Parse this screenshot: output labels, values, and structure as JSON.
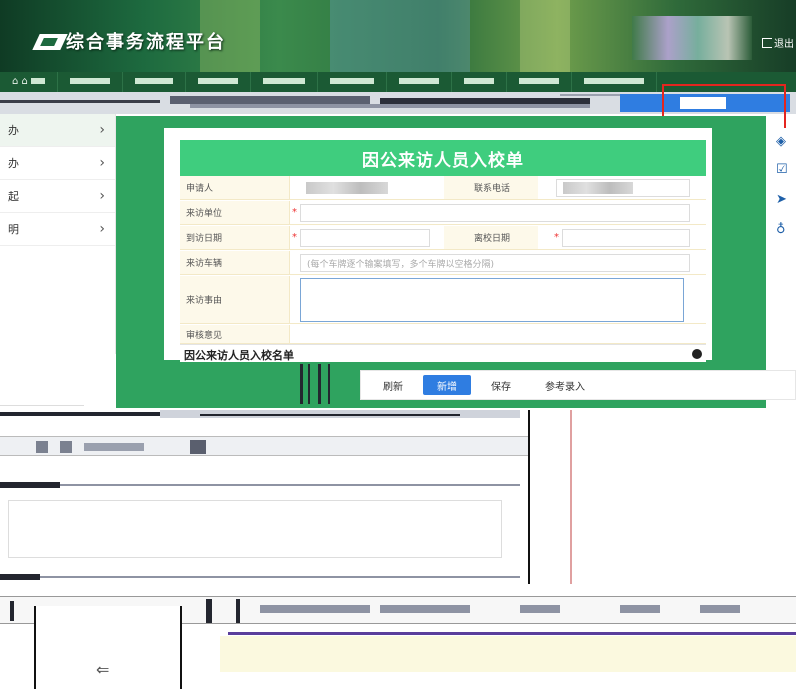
{
  "app": {
    "title": "综合事务流程平台",
    "logout_label": "退出"
  },
  "nav": {
    "items": [
      "",
      "",
      "",
      "",
      "",
      "",
      "",
      "",
      "",
      "",
      ""
    ]
  },
  "sidebar": {
    "items": [
      {
        "label": "办",
        "active": true
      },
      {
        "label": "办",
        "active": false
      },
      {
        "label": "起",
        "active": false
      },
      {
        "label": "明",
        "active": false
      }
    ]
  },
  "form": {
    "title": "因公来访人员入校单",
    "applicant_label": "申请人",
    "phone_label": "联系电话",
    "visit_unit_label": "来访单位",
    "arrive_date_label": "到访日期",
    "leave_date_label": "离校日期",
    "vehicle_label": "来访车辆",
    "vehicle_placeholder": "(每个车牌逐个输案填写，多个车牌以空格分隔)",
    "reason_label": "来访事由",
    "review_label": "审核意见",
    "list_title": "因公来访人员入校名单"
  },
  "toolbar": {
    "refresh_label": "刷新",
    "add_label": "新增",
    "save_label": "保存",
    "reference_label": "参考录入"
  },
  "colors": {
    "brand_green": "#3fcd7e",
    "canvas_green": "#2fa35f",
    "accent_blue": "#2f7de1",
    "highlight_red": "#e4251f"
  }
}
